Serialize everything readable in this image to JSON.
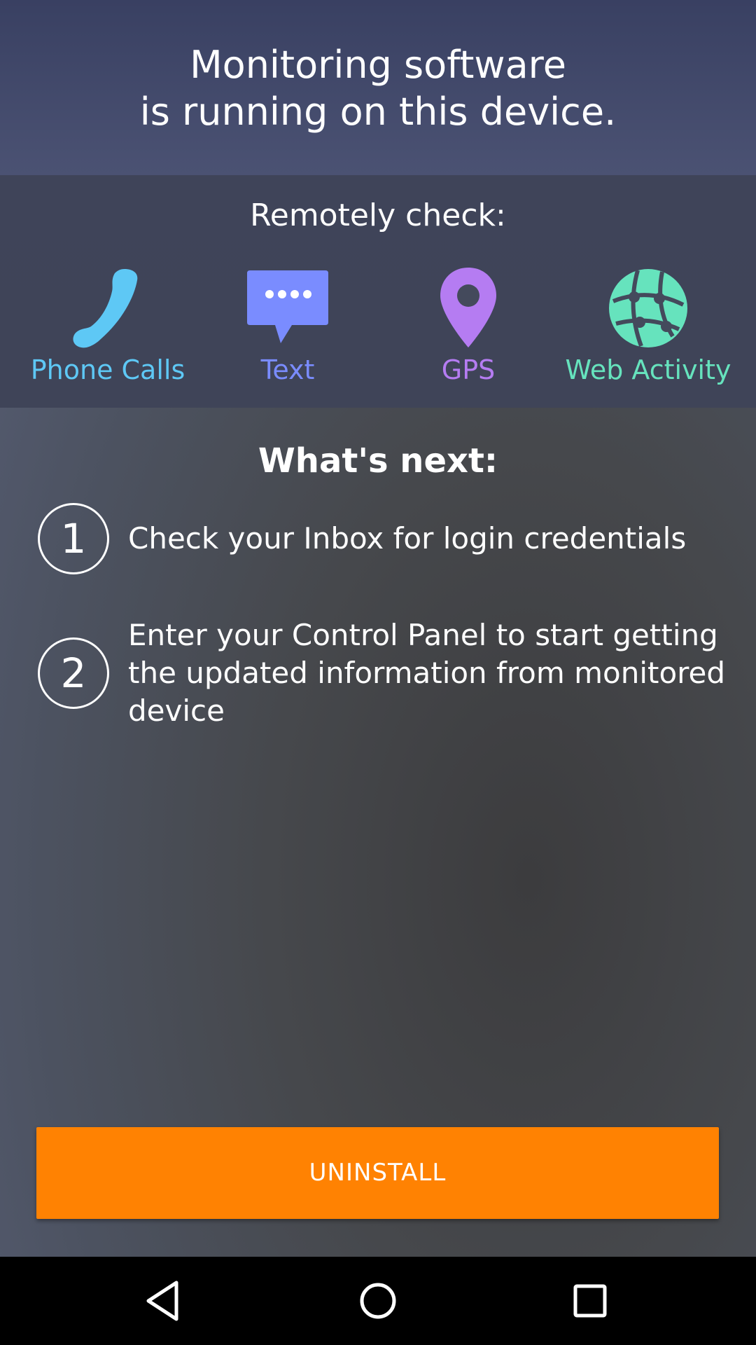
{
  "header": {
    "line1": "Monitoring software",
    "line2": "is running on this device."
  },
  "features": {
    "title": "Remotely check:",
    "items": [
      {
        "label": "Phone Calls",
        "icon": "phone-icon",
        "color": "#5ec8f5"
      },
      {
        "label": "Text",
        "icon": "message-icon",
        "color": "#7a8cff"
      },
      {
        "label": "GPS",
        "icon": "map-pin-icon",
        "color": "#b57cf2"
      },
      {
        "label": "Web Activity",
        "icon": "globe-icon",
        "color": "#66e3bd"
      }
    ]
  },
  "next": {
    "title": "What's next:",
    "steps": [
      {
        "number": "1",
        "text": "Check your Inbox for login credentials"
      },
      {
        "number": "2",
        "text": "Enter your Control Panel to start getting the updated information from monitored device"
      }
    ]
  },
  "actions": {
    "uninstall_label": "UNINSTALL",
    "uninstall_color": "#ff8202"
  },
  "navbar": {
    "buttons": [
      "back-icon",
      "home-icon",
      "recent-apps-icon"
    ]
  }
}
